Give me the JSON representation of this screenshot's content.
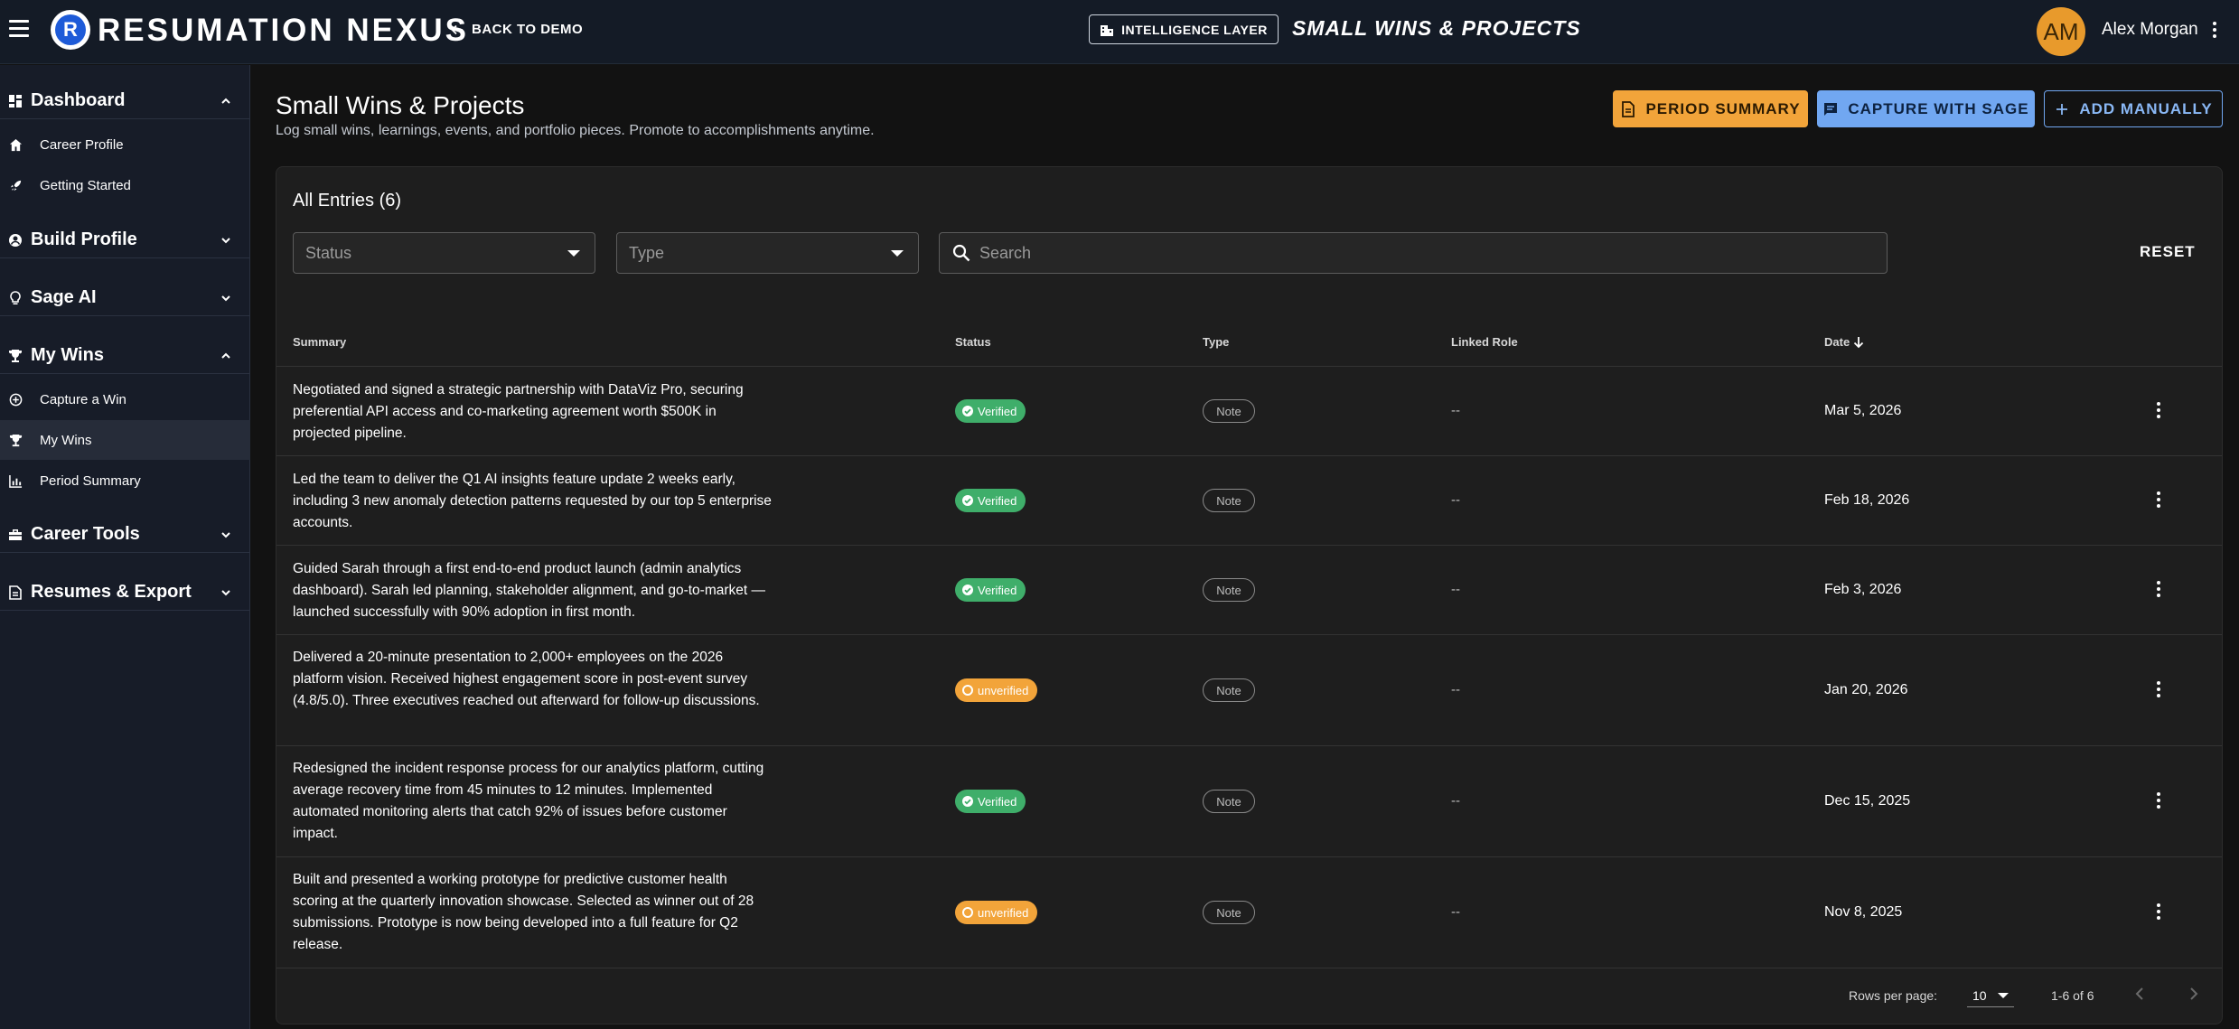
{
  "topbar": {
    "brand": "RESUMATION NEXUS",
    "logo_letter": "R",
    "back_label": "BACK TO DEMO",
    "intel_label": "INTELLIGENCE LAYER",
    "page_label": "SMALL WINS & PROJECTS",
    "avatar_initials": "AM",
    "user_name": "Alex Morgan"
  },
  "sidebar": {
    "sections": [
      {
        "label": "Dashboard",
        "icon": "dashboard-icon",
        "expanded": true,
        "items": [
          {
            "label": "Career Profile",
            "icon": "home-icon"
          },
          {
            "label": "Getting Started",
            "icon": "rocket-icon"
          }
        ]
      },
      {
        "label": "Build Profile",
        "icon": "account-circle-icon",
        "expanded": false,
        "items": []
      },
      {
        "label": "Sage AI",
        "icon": "lightbulb-icon",
        "expanded": false,
        "items": []
      },
      {
        "label": "My Wins",
        "icon": "trophy-icon",
        "expanded": true,
        "items": [
          {
            "label": "Capture a Win",
            "icon": "add-circle-icon"
          },
          {
            "label": "My Wins",
            "icon": "trophy-icon",
            "active": true
          },
          {
            "label": "Period Summary",
            "icon": "bar-chart-icon"
          }
        ]
      },
      {
        "label": "Career Tools",
        "icon": "toolbox-icon",
        "expanded": false,
        "items": []
      },
      {
        "label": "Resumes & Export",
        "icon": "document-icon",
        "expanded": false,
        "items": []
      }
    ]
  },
  "header": {
    "title": "Small Wins & Projects",
    "subtitle": "Log small wins, learnings, events, and portfolio pieces. Promote to accomplishments anytime.",
    "btn_summary": "PERIOD SUMMARY",
    "btn_sage": "CAPTURE WITH SAGE",
    "btn_manual": "ADD MANUALLY"
  },
  "filters": {
    "card_title": "All Entries (6)",
    "status_placeholder": "Status",
    "type_placeholder": "Type",
    "search_placeholder": "Search",
    "reset": "RESET"
  },
  "table": {
    "columns": [
      "Summary",
      "Status",
      "Type",
      "Linked Role",
      "Date"
    ],
    "rows": [
      {
        "summary": "Negotiated and signed a strategic partnership with DataViz Pro, securing preferential API access and co-marketing agreement worth $500K in projected pipeline.",
        "status": "Verified",
        "type": "Note",
        "linked": "--",
        "date": "Mar 5, 2026"
      },
      {
        "summary": "Led the team to deliver the Q1 AI insights feature update 2 weeks early, including 3 new anomaly detection patterns requested by our top 5 enterprise accounts.",
        "status": "Verified",
        "type": "Note",
        "linked": "--",
        "date": "Feb 18, 2026"
      },
      {
        "summary": "Guided Sarah through a first end-to-end product launch (admin analytics dashboard). Sarah led planning, stakeholder alignment, and go-to-market — launched successfully with 90% adoption in first month.",
        "status": "Verified",
        "type": "Note",
        "linked": "--",
        "date": "Feb 3, 2026"
      },
      {
        "summary": "Delivered a 20-minute presentation to 2,000+ employees on the 2026 platform vision. Received highest engagement score in post-event survey (4.8/5.0). Three executives reached out afterward for follow-up discussions.",
        "status": "unverified",
        "type": "Note",
        "linked": "--",
        "date": "Jan 20, 2026"
      },
      {
        "summary": "Redesigned the incident response process for our analytics platform, cutting average recovery time from 45 minutes to 12 minutes. Implemented automated monitoring alerts that catch 92% of issues before customer impact.",
        "status": "Verified",
        "type": "Note",
        "linked": "--",
        "date": "Dec 15, 2025"
      },
      {
        "summary": "Built and presented a working prototype for predictive customer health scoring at the quarterly innovation showcase. Selected as winner out of 28 submissions. Prototype is now being developed into a full feature for Q2 release.",
        "status": "unverified",
        "type": "Note",
        "linked": "--",
        "date": "Nov 8, 2025"
      }
    ]
  },
  "footer": {
    "rows_per_page_label": "Rows per page:",
    "rows_per_page": "10",
    "range": "1-6 of 6"
  },
  "colors": {
    "verified": "#3fae6a",
    "unverified": "#f2a43a",
    "accent_blue": "#71a7f1",
    "accent_orange": "#f2a43a"
  }
}
